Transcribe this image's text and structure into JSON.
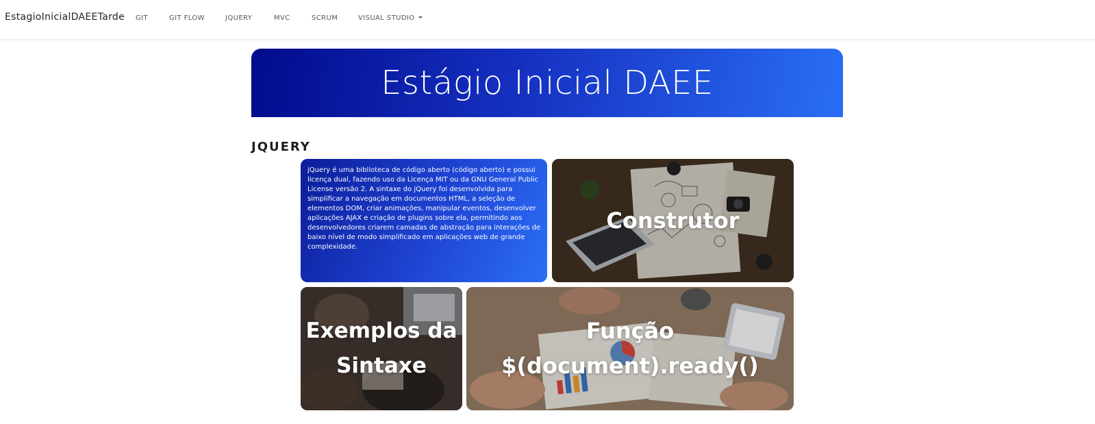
{
  "navbar": {
    "brand": "EstagioInicialDAEETarde",
    "links": [
      {
        "label": "GIT"
      },
      {
        "label": "GIT FLOW"
      },
      {
        "label": "JQUERY"
      },
      {
        "label": "MVC"
      },
      {
        "label": "SCRUM"
      },
      {
        "label": "VISUAL STUDIO"
      }
    ]
  },
  "hero": {
    "title": "Estágio Inicial DAEE"
  },
  "section": {
    "heading": "JQUERY"
  },
  "cards": {
    "description": "jQuery é uma biblioteca de código aberto (código aberto) e possui licença dual, fazendo uso da Licença MIT ou da GNU General Public License versão 2. A sintaxe do jQuery foi desenvolvida para simplificar a navegação em documentos HTML, a seleção de elementos DOM, criar animações, manipular eventos, desenvolver aplicações AJAX e criação de plugins sobre ela, permitindo aos desenvolvedores criarem camadas de abstração para interações de baixo nível de modo simplificado em aplicações web de grande complexidade.",
    "construtor": {
      "title": "Construtor"
    },
    "exemplos": {
      "title": "Exemplos da Sintaxe"
    },
    "funcao": {
      "title": "Função $(document).ready()"
    }
  },
  "colors": {
    "hero_start": "#020b8c",
    "hero_end": "#2a6ef6",
    "accent": "#1f45d4"
  }
}
